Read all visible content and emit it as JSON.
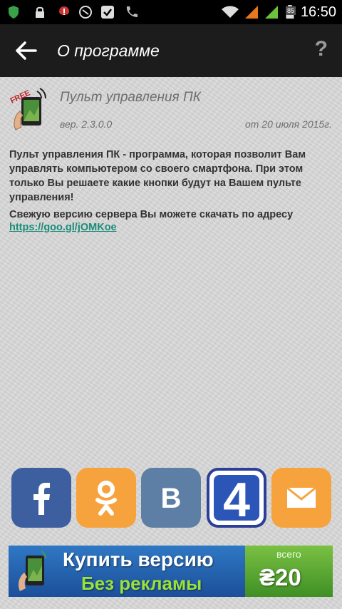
{
  "status_bar": {
    "time": "16:50",
    "battery_level": "85",
    "icons": [
      "shield-icon",
      "lock-icon",
      "alert-icon",
      "whatsapp-icon",
      "check-icon",
      "phone-icon",
      "wifi-icon",
      "signal-icon",
      "signal-icon",
      "battery-icon"
    ]
  },
  "app_bar": {
    "title": "О программе",
    "help_label": "?"
  },
  "about": {
    "app_name": "Пульт управления ПК",
    "version": "вер. 2.3.0.0",
    "date": "от 20 июля 2015г.",
    "description": "Пульт управления ПК - программа, которая позволит Вам управлять компьютером со своего смартфона. При этом только Вы решаете какие кнопки будут на Вашем пульте управления!",
    "server_text": "Свежую версию сервера Вы можете скачать по адресу",
    "server_link": "https://goo.gl/jOMKoe",
    "logo_badge": "FREE"
  },
  "social": [
    {
      "name": "facebook",
      "label": "f",
      "color": "#3d5fa0"
    },
    {
      "name": "odnoklassniki",
      "label": "ok",
      "color": "#f6a33d"
    },
    {
      "name": "vkontakte",
      "label": "B",
      "color": "#5d7ea5"
    },
    {
      "name": "4pda",
      "label": "4",
      "color": "#2b3f9a"
    },
    {
      "name": "email",
      "label": "mail",
      "color": "#f6a33d"
    }
  ],
  "buy_banner": {
    "line1": "Купить версию",
    "line2": "Без рекламы",
    "price_label": "всего",
    "price_value": "₴20"
  }
}
